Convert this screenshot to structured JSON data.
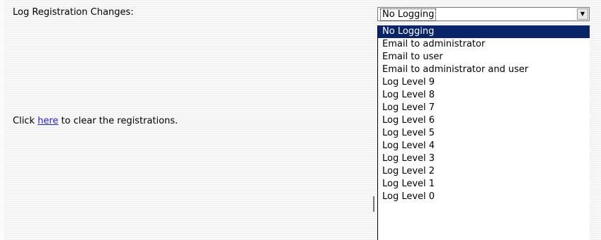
{
  "form": {
    "log_label": "Log Registration Changes:",
    "clear_prefix": "Click ",
    "clear_link": "here",
    "clear_suffix": " to clear the registrations."
  },
  "select": {
    "current_value": "No Logging",
    "arrow_icon": "chevron-down-icon",
    "options": [
      "No Logging",
      "Email to administrator",
      "Email to user",
      "Email to administrator and user",
      "Log Level 9",
      "Log Level 8",
      "Log Level 7",
      "Log Level 6",
      "Log Level 5",
      "Log Level 4",
      "Log Level 3",
      "Log Level 2",
      "Log Level 1",
      "Log Level 0"
    ],
    "selected_index": 0
  },
  "colors": {
    "selection_bg": "#0a246a",
    "link": "#2222cc"
  }
}
